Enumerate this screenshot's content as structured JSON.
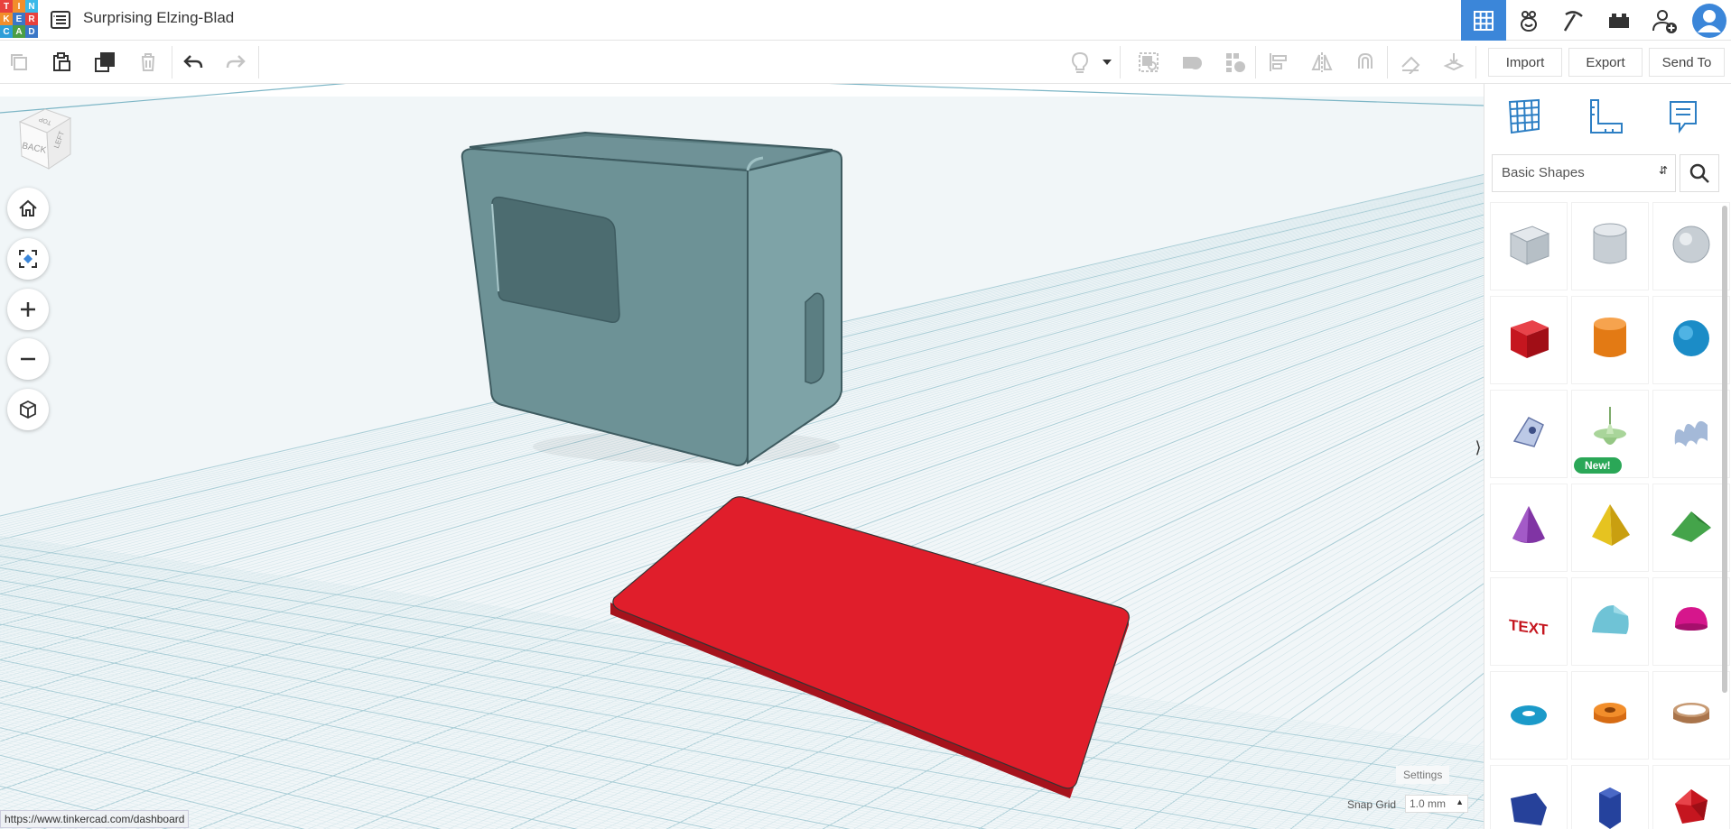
{
  "app": {
    "logo_letters": [
      "T",
      "I",
      "N",
      "K",
      "E",
      "R",
      "C",
      "A",
      "D"
    ],
    "logo_colors": [
      "#e8413d",
      "#f28e2b",
      "#3ab9e8",
      "#f28e2b",
      "#3a77c7",
      "#e8413d",
      "#2c9ed8",
      "#4b9e45",
      "#3a77c7"
    ],
    "title": "Surprising Elzing-Blad"
  },
  "topnav": {
    "icons": [
      "grid-view-icon",
      "blocks-icon",
      "minecraft-pickaxe-icon",
      "bricks-icon",
      "add-user-icon",
      "avatar"
    ],
    "active_color": "#3b86d9"
  },
  "toolbar": {
    "left_icons": [
      "copy-icon",
      "paste-icon",
      "duplicate-icon",
      "delete-icon",
      "undo-icon",
      "redo-icon"
    ],
    "right_icons": [
      "light-bulb-icon",
      "dropdown-icon",
      "group-icon",
      "solid-icon",
      "hole-icon",
      "align-icon",
      "mirror-icon",
      "magnet-icon",
      "ruler-tools-icon",
      "drop-icon"
    ],
    "import_label": "Import",
    "export_label": "Export",
    "send_to_label": "Send To"
  },
  "viewcube": {
    "top_label": "TOP",
    "back_label": "BACK",
    "left_label": "LEFT"
  },
  "navigation": [
    "home-icon",
    "fit-view-icon",
    "zoom-in-icon",
    "zoom-out-icon",
    "perspective-icon"
  ],
  "objects": {
    "box_color": "#6d9296",
    "plate_color": "#e01e2b"
  },
  "workplane": {
    "settings_label": "Settings",
    "snap_grid_label": "Snap Grid",
    "snap_grid_value": "1.0 mm",
    "status_url": "https://www.tinkercad.com/dashboard"
  },
  "panel": {
    "tabs": [
      "workplane-icon",
      "ruler-icon",
      "notes-icon"
    ],
    "category": "Basic Shapes",
    "new_badge": "New!",
    "shapes": [
      "box-hole",
      "cylinder-hole",
      "sphere-hole",
      "box",
      "cylinder",
      "sphere",
      "scribble",
      "new-shape",
      "text-squiggle",
      "cone",
      "pyramid",
      "roof",
      "text",
      "round-roof",
      "half-sphere",
      "torus",
      "tube",
      "ring",
      "polygon",
      "hexagonal-prism",
      "icosahedron"
    ]
  }
}
